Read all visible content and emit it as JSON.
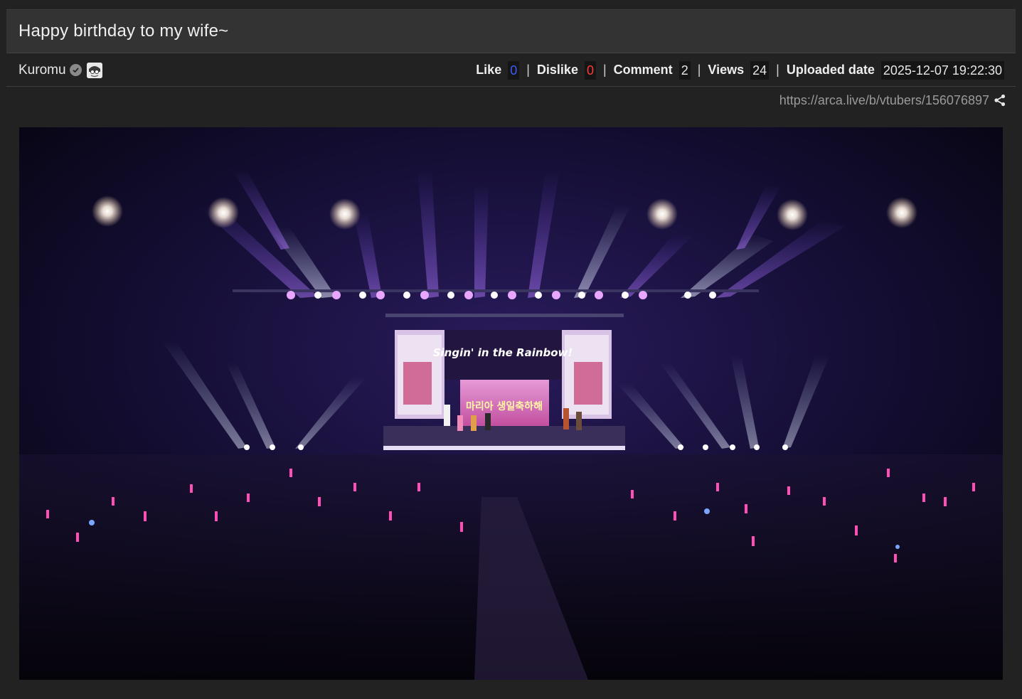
{
  "post": {
    "title": "Happy birthday to my wife~",
    "author": "Kuromu",
    "url": "https://arca.live/b/vtubers/156076897"
  },
  "stats": {
    "like_label": "Like",
    "like_value": "0",
    "dislike_label": "Dislike",
    "dislike_value": "0",
    "comment_label": "Comment",
    "comment_value": "2",
    "views_label": "Views",
    "views_value": "24",
    "uploaded_label": "Uploaded date",
    "uploaded_value": "2025-12-07 19:22:30",
    "separator": "|"
  },
  "image": {
    "stage_title": "Singin' in the Rainbow!",
    "screen_text": "마리아 생일축하해"
  },
  "colors": {
    "like": "#3a5cff",
    "dislike": "#ff3a3a",
    "background": "#222222"
  },
  "icons": {
    "verified": "verified-badge-icon",
    "share": "share-icon"
  }
}
